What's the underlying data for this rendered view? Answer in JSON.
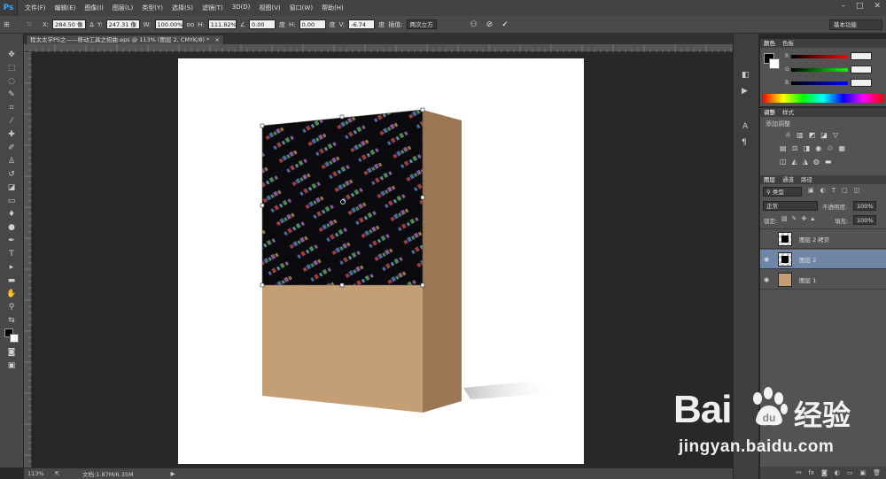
{
  "app": {
    "logo": "Ps"
  },
  "menu": [
    "文件(F)",
    "编辑(E)",
    "图像(I)",
    "图层(L)",
    "类型(Y)",
    "选择(S)",
    "滤镜(T)",
    "3D(D)",
    "视图(V)",
    "窗口(W)",
    "帮助(H)"
  ],
  "options": {
    "x_label": "X:",
    "x_value": "284.50 像",
    "y_label": "Y:",
    "y_value": "247.31 像",
    "w_label": "W:",
    "w_value": "100.00%",
    "link_label": "oo",
    "h_label": "H:",
    "h_value": "111.82%",
    "angle_value": "0.00",
    "deg1": "度",
    "hskew_label": "H:",
    "hskew_value": "0.00",
    "deg2": "度",
    "vskew_label": "V:",
    "vskew_value": "-6.74",
    "deg3": "度",
    "interp_label": "插值:",
    "interp_value": "两次立方",
    "workspace": "基本功能"
  },
  "document": {
    "tab_title": "程太太学PS之——移动工具之招曲.eps @ 113% (图层 2, CMYK/8) *",
    "zoom": "113%",
    "doc_info": "文档:1.87M/6.35M"
  },
  "color_panel": {
    "tabs": [
      "颜色",
      "色板"
    ],
    "r": "R",
    "g": "G",
    "b": "B"
  },
  "adjust_panel": {
    "tabs": [
      "调整",
      "样式"
    ],
    "heading": "添加调整"
  },
  "layers_panel": {
    "tabs": [
      "图层",
      "通道",
      "路径"
    ],
    "filter": "类型",
    "blend_mode": "正常",
    "opacity_label": "不透明度:",
    "opacity_value": "100%",
    "lock_label": "锁定:",
    "fill_label": "填充:",
    "fill_value": "100%",
    "layers": [
      {
        "name": "图层 2 拷贝",
        "visible": false,
        "selected": false
      },
      {
        "name": "图层 2",
        "visible": true,
        "selected": true
      },
      {
        "name": "图层 1",
        "visible": true,
        "selected": false
      }
    ]
  },
  "watermark": {
    "brand": "Bai",
    "brand2": "经验",
    "url": "jingyan.baidu.com"
  },
  "colors": {
    "box_front": "#c49e74",
    "box_side": "#9a7654",
    "pattern_bg": "#0b0b0f",
    "selected_layer": "#6f86a6"
  }
}
